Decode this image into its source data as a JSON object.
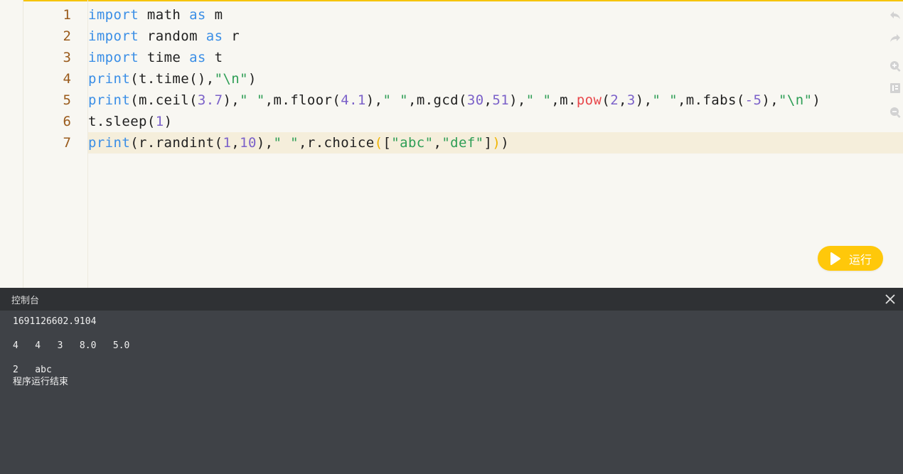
{
  "editor": {
    "lines": [
      {
        "num": "1",
        "tokens": [
          {
            "t": "import",
            "c": "kw"
          },
          {
            "t": " math ",
            "c": ""
          },
          {
            "t": "as",
            "c": "kw"
          },
          {
            "t": " m",
            "c": ""
          }
        ]
      },
      {
        "num": "2",
        "tokens": [
          {
            "t": "import",
            "c": "kw"
          },
          {
            "t": " random ",
            "c": ""
          },
          {
            "t": "as",
            "c": "kw"
          },
          {
            "t": " r",
            "c": ""
          }
        ]
      },
      {
        "num": "3",
        "tokens": [
          {
            "t": "import",
            "c": "kw"
          },
          {
            "t": " time ",
            "c": ""
          },
          {
            "t": "as",
            "c": "kw"
          },
          {
            "t": " t",
            "c": ""
          }
        ]
      },
      {
        "num": "4",
        "tokens": [
          {
            "t": "print",
            "c": "kw"
          },
          {
            "t": "(t.time(),",
            "c": ""
          },
          {
            "t": "\"\\n\"",
            "c": "str"
          },
          {
            "t": ")",
            "c": ""
          }
        ]
      },
      {
        "num": "5",
        "tokens": [
          {
            "t": "print",
            "c": "kw"
          },
          {
            "t": "(m.ceil(",
            "c": ""
          },
          {
            "t": "3.7",
            "c": "num"
          },
          {
            "t": "),",
            "c": ""
          },
          {
            "t": "\" \"",
            "c": "str"
          },
          {
            "t": ",m.floor(",
            "c": ""
          },
          {
            "t": "4.1",
            "c": "num"
          },
          {
            "t": "),",
            "c": ""
          },
          {
            "t": "\" \"",
            "c": "str"
          },
          {
            "t": ",m.gcd(",
            "c": ""
          },
          {
            "t": "30",
            "c": "num"
          },
          {
            "t": ",",
            "c": ""
          },
          {
            "t": "51",
            "c": "num"
          },
          {
            "t": "),",
            "c": ""
          },
          {
            "t": "\" \"",
            "c": "str"
          },
          {
            "t": ",m.",
            "c": ""
          },
          {
            "t": "pow",
            "c": "fn-red"
          },
          {
            "t": "(",
            "c": ""
          },
          {
            "t": "2",
            "c": "num"
          },
          {
            "t": ",",
            "c": ""
          },
          {
            "t": "3",
            "c": "num"
          },
          {
            "t": "),",
            "c": ""
          },
          {
            "t": "\" \"",
            "c": "str"
          },
          {
            "t": ",m.fabs(",
            "c": ""
          },
          {
            "t": "-5",
            "c": "num"
          },
          {
            "t": "),",
            "c": ""
          },
          {
            "t": "\"\\n\"",
            "c": "str"
          },
          {
            "t": ")",
            "c": ""
          }
        ]
      },
      {
        "num": "6",
        "tokens": [
          {
            "t": "t.sleep(",
            "c": ""
          },
          {
            "t": "1",
            "c": "num"
          },
          {
            "t": ")",
            "c": ""
          }
        ]
      },
      {
        "num": "7",
        "tokens": [
          {
            "t": "print",
            "c": "kw"
          },
          {
            "t": "(r.randint(",
            "c": ""
          },
          {
            "t": "1",
            "c": "num"
          },
          {
            "t": ",",
            "c": ""
          },
          {
            "t": "10",
            "c": "num"
          },
          {
            "t": "),",
            "c": ""
          },
          {
            "t": "\" \"",
            "c": "str"
          },
          {
            "t": ",r.choice",
            "c": ""
          },
          {
            "t": "(",
            "c": "brk"
          },
          {
            "t": "[",
            "c": ""
          },
          {
            "t": "\"abc\"",
            "c": "str"
          },
          {
            "t": ",",
            "c": ""
          },
          {
            "t": "\"def\"",
            "c": "str"
          },
          {
            "t": "]",
            "c": ""
          },
          {
            "t": ")",
            "c": "brk"
          },
          {
            "t": ")",
            "c": ""
          }
        ]
      }
    ]
  },
  "toolbar": {
    "tools": [
      {
        "name": "undo-icon"
      },
      {
        "name": "redo-icon"
      },
      {
        "name": "zoom-in-icon"
      },
      {
        "name": "format-icon"
      },
      {
        "name": "zoom-out-icon"
      }
    ]
  },
  "run_button": {
    "label": "运行"
  },
  "console": {
    "title": "控制台",
    "output": "1691126602.9104\n\n4   4   3   8.0   5.0\n\n2   abc\n程序运行结束"
  },
  "colors": {
    "accent": "#ffc80a",
    "keyword": "#3a8ee6",
    "string": "#2e9e56",
    "number": "#7b61c9",
    "console_bg": "#3f4247"
  }
}
